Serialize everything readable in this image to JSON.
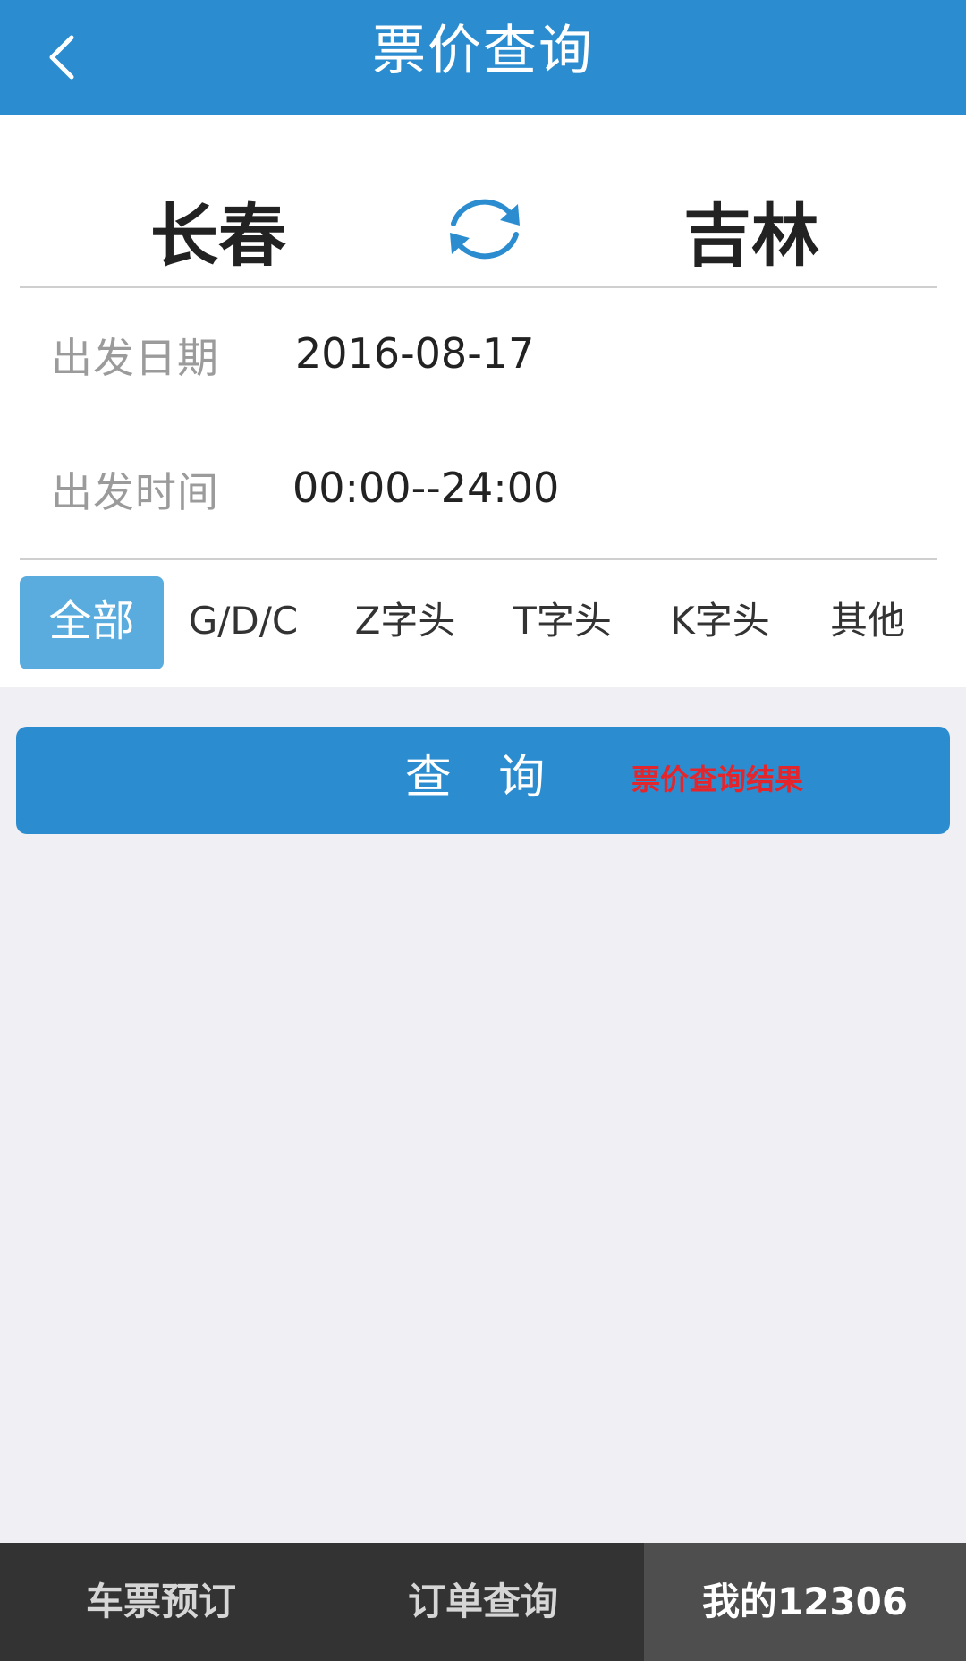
{
  "header": {
    "title": "票价查询",
    "back_icon": "chevron-left-icon"
  },
  "route": {
    "from": "长春",
    "to": "吉林",
    "swap_icon": "swap-arrows-icon"
  },
  "date_row": {
    "label": "出发日期",
    "value": "2016-08-17"
  },
  "time_row": {
    "label": "出发时间",
    "value": "00:00--24:00"
  },
  "filters": {
    "selected": "全部",
    "items": [
      "全部",
      "G/D/C",
      "Z字头",
      "T字头",
      "K字头",
      "其他"
    ]
  },
  "query": {
    "label": "查 询",
    "hint": "票价查询结果"
  },
  "tabbar": {
    "selected": "我的12306",
    "items": [
      "车票预订",
      "订单查询",
      "我的12306"
    ]
  },
  "colors": {
    "primary": "#2b8dd0",
    "filter_active": "#5aacde",
    "hint_red": "#e4252b",
    "tabbar_bg": "#333333",
    "tabbar_active": "#4e4e4e",
    "page_bg": "#efeff4"
  }
}
